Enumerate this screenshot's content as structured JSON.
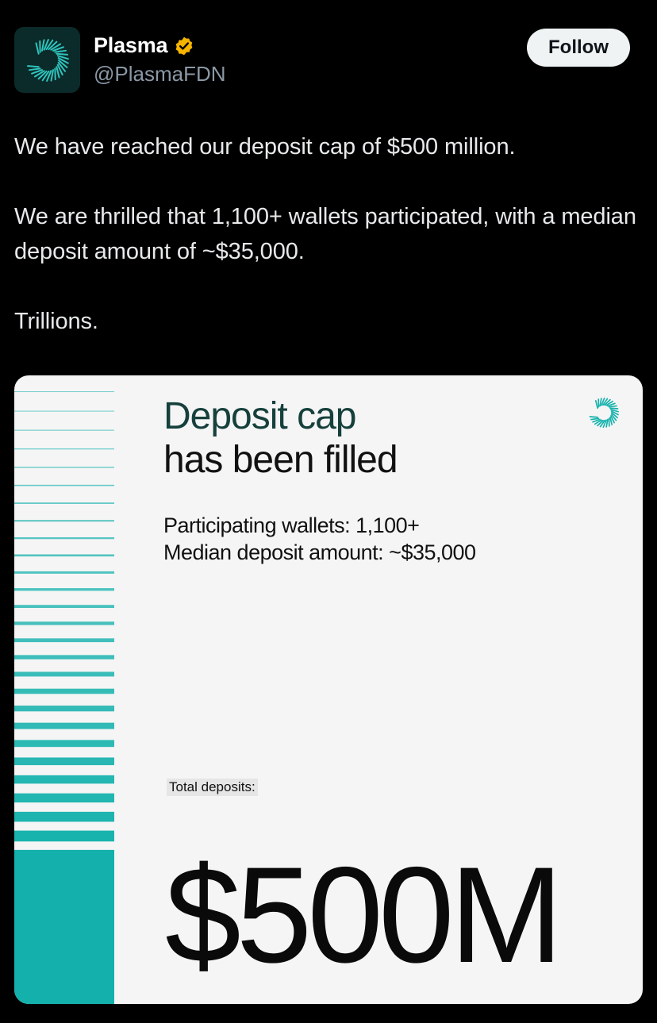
{
  "author": {
    "display_name": "Plasma",
    "handle": "@PlasmaFDN",
    "verified_icon": "verified-gold-badge-icon",
    "avatar_icon": "plasma-logo-icon"
  },
  "follow_button": {
    "label": "Follow"
  },
  "tweet": {
    "paragraphs": [
      "We have reached our deposit cap of $500 million.",
      "We are thrilled that 1,100+ wallets participated, with a median deposit amount of ~$35,000.",
      "Trillions."
    ]
  },
  "media": {
    "title_line1": "Deposit cap",
    "title_line2": "has been filled",
    "participating_wallets": "Participating wallets: 1,100+",
    "median_deposit": "Median deposit amount: ~$35,000",
    "total_label": "Total deposits:",
    "total_amount": "$500M",
    "logo_icon": "plasma-logo-icon"
  },
  "colors": {
    "background": "#000000",
    "teal_accent": "#14b1ac",
    "verified_gold": "#f4b400",
    "card_background": "#f5f5f5"
  }
}
